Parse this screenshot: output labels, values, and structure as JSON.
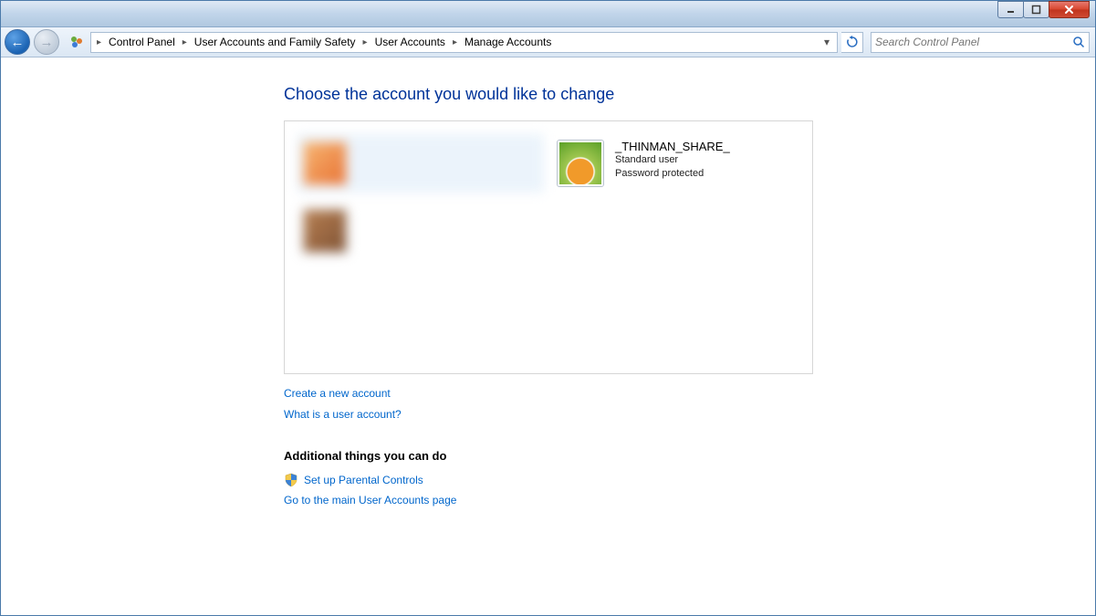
{
  "breadcrumb": {
    "items": [
      "Control Panel",
      "User Accounts and Family Safety",
      "User Accounts",
      "Manage Accounts"
    ]
  },
  "search": {
    "placeholder": "Search Control Panel"
  },
  "page": {
    "title": "Choose the account you would like to change"
  },
  "accounts": [
    {
      "name": "",
      "type": "",
      "status": "",
      "blurred": true,
      "selected": true,
      "avatar_bg": "linear-gradient(135deg,#f7b26a,#e86b2a)"
    },
    {
      "name": "_THINMAN_SHARE_",
      "type": "Standard user",
      "status": "Password protected",
      "blurred": false,
      "selected": false,
      "avatar_bg": "radial-gradient(circle at 50% 70%, #f19a2a 0%, #f19a2a 35%, #fff 38%, #9fc64f 42%, #5aa028 100%)"
    },
    {
      "name": "",
      "type": "",
      "status": "",
      "blurred": true,
      "selected": false,
      "avatar_bg": "linear-gradient(135deg,#b47a4a,#7a4a2a)"
    }
  ],
  "links": {
    "create": "Create a new account",
    "what_is": "What is a user account?",
    "additional_title": "Additional things you can do",
    "parental": "Set up Parental Controls",
    "main_page": "Go to the main User Accounts page"
  }
}
